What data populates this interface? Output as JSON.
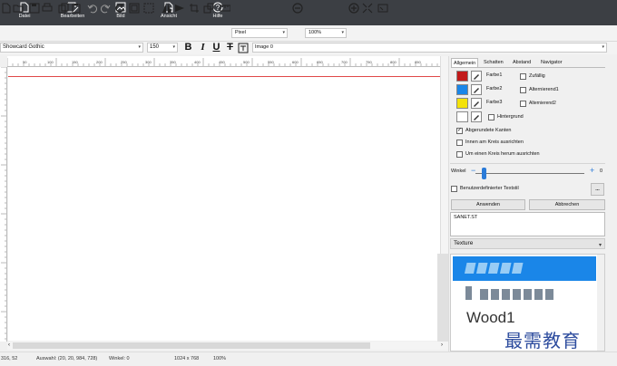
{
  "menu": [
    {
      "label": "Datei",
      "icon": "file-icon"
    },
    {
      "label": "Bearbeiten",
      "icon": "edit-icon"
    },
    {
      "label": "Bild",
      "icon": "image-icon"
    },
    {
      "label": "Ansicht",
      "icon": "view-icon"
    },
    {
      "label": "Hilfe",
      "icon": "help-icon"
    }
  ],
  "toolbar": {
    "unit": "Pixel",
    "zoom": "100%"
  },
  "format": {
    "font": "Showcard Gothic",
    "size": "150",
    "bold": "B",
    "italic": "I",
    "underline": "U",
    "strike": "T",
    "layer": "Image 0"
  },
  "ruler": {
    "h_ticks": [
      "50",
      "100",
      "150",
      "200",
      "250",
      "300",
      "350",
      "400",
      "450",
      "500",
      "550",
      "600",
      "650",
      "700",
      "750",
      "800",
      "850"
    ]
  },
  "panel": {
    "tabs": [
      "Allgemein",
      "Schatten",
      "Abstand",
      "Navigator"
    ],
    "colors": [
      {
        "label": "Farbe1",
        "color": "#c21a1a",
        "option": "Zufällig"
      },
      {
        "label": "Farbe2",
        "color": "#1a86e8",
        "option": "Alternierend1"
      },
      {
        "label": "Farbe3",
        "color": "#f4e20a",
        "option": "Alternierend2"
      },
      {
        "label": "",
        "color": "#ffffff",
        "option": "Hintergrund"
      }
    ],
    "checks": {
      "rounded": "Abgerundete Kanten",
      "inner": "Innen am Kreis ausrichten",
      "around": "Um einen Kreis herum ausrichten"
    },
    "angle_label": "Winkel",
    "angle_value": "0",
    "custom_style": "Benutzerdefinierter Textstil",
    "more": "...",
    "apply": "Anwenden",
    "cancel": "Abbrechen",
    "text_value": "SANET.ST",
    "texture_header": "Texture",
    "textures": [
      "",
      "",
      "Wood1"
    ]
  },
  "status": {
    "pos": "316, 52",
    "selection": "Auswahl: (20, 20, 984, 728)",
    "angle": "Winkel: 0",
    "size": "1024 x 768",
    "zoom": "100%"
  },
  "watermark": "最需教育"
}
